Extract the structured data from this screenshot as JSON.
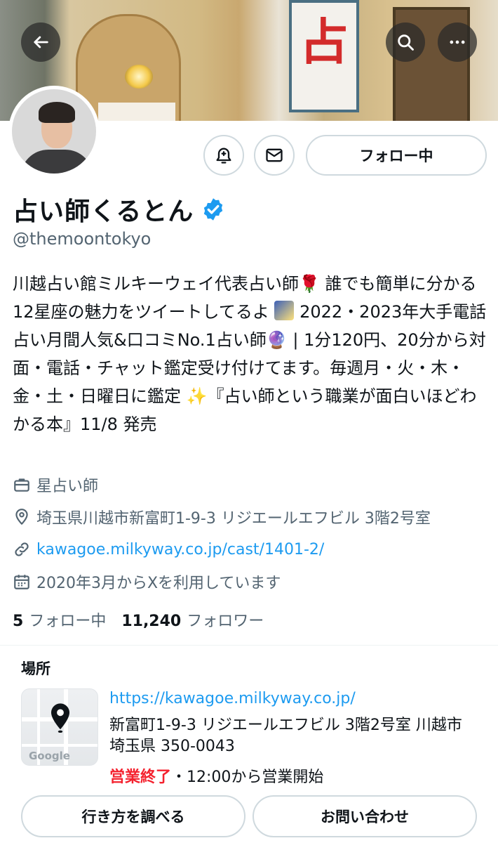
{
  "banner": {
    "sign_char": "占"
  },
  "profile": {
    "name": "占い師くるとん",
    "handle": "@themoontokyo",
    "follow_label": "フォロー中"
  },
  "bio": {
    "line1a": "川越占い館ミルキーウェイ代表占い師",
    "rose": "🌹",
    "line1b": "誰でも簡単に分かる12星座の魅力をツイートしてるよ",
    "line1c": "2022・2023年大手電話占い月間人気&口コミNo.1占い師",
    "ball": "🔮",
    "line1d": "| 1分120円、20分から対面・電話・チャット鑑定受け付けてます。毎週月・火・木・金・土・日曜日に鑑定",
    "sparkle": "✨",
    "line1e": "『占い師という職業が面白いほどわかる本』11/8 発売"
  },
  "meta": {
    "profession": "星占い師",
    "location": "埼玉県川越市新富町1-9-3 リジエールエフビル 3階2号室",
    "website": "kawagoe.milkyway.co.jp/cast/1401-2/",
    "joined": "2020年3月からXを利用しています"
  },
  "counts": {
    "following_num": "5",
    "following_label": "フォロー中",
    "followers_num": "11,240",
    "followers_label": "フォロワー"
  },
  "location_card": {
    "title": "場所",
    "map_logo": "Google",
    "url": "https://kawagoe.milkyway.co.jp/",
    "address": "新富町1-9-3 リジエールエフビル 3階2号室 川越市 埼玉県 350-0043",
    "status_closed": "営業終了",
    "status_rest": "・12:00から営業開始",
    "directions_label": "行き方を調べる",
    "contact_label": "お問い合わせ"
  },
  "colors": {
    "accent": "#1d9bf0",
    "closed": "#f4212e",
    "muted": "#536471"
  },
  "icons": [
    "back-arrow-icon",
    "search-icon",
    "more-icon",
    "notification-bell-icon",
    "mail-icon",
    "verified-badge-icon",
    "briefcase-icon",
    "location-pin-icon",
    "link-icon",
    "calendar-icon",
    "map-pin-icon"
  ]
}
